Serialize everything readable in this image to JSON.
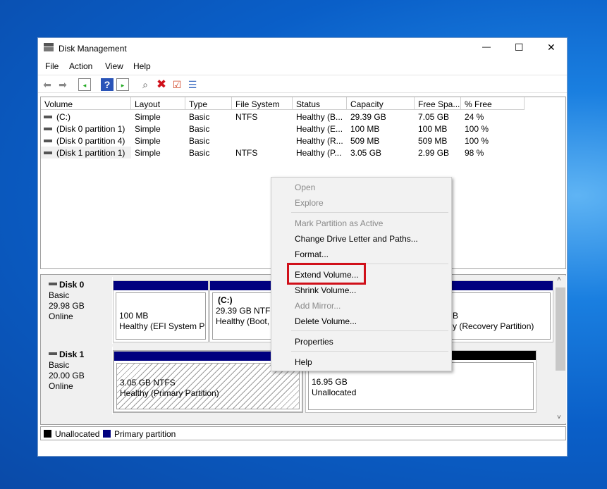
{
  "window": {
    "title": "Disk Management",
    "controls": {
      "minimize": "—",
      "maximize": "☐",
      "close": "✕"
    }
  },
  "menu": [
    "File",
    "Action",
    "View",
    "Help"
  ],
  "toolbar": [
    "back-icon",
    "forward-icon",
    "show-hide-console-tree-icon",
    "help-icon",
    "show-hide-action-pane-icon",
    "connect-disk-icon",
    "delete-icon",
    "properties-icon",
    "list-icon"
  ],
  "columns": [
    "Volume",
    "Layout",
    "Type",
    "File System",
    "Status",
    "Capacity",
    "Free Spa...",
    "% Free"
  ],
  "rows": [
    [
      "(C:)",
      "Simple",
      "Basic",
      "NTFS",
      "Healthy (B...",
      "29.39 GB",
      "7.05 GB",
      "24 %"
    ],
    [
      "(Disk 0 partition 1)",
      "Simple",
      "Basic",
      "",
      "Healthy (E...",
      "100 MB",
      "100 MB",
      "100 %"
    ],
    [
      "(Disk 0 partition 4)",
      "Simple",
      "Basic",
      "",
      "Healthy (R...",
      "509 MB",
      "509 MB",
      "100 %"
    ],
    [
      "(Disk 1 partition 1)",
      "Simple",
      "Basic",
      "NTFS",
      "Healthy (P...",
      "3.05 GB",
      "2.99 GB",
      "98 %"
    ]
  ],
  "disks": [
    {
      "name": "Disk 0",
      "type": "Basic",
      "size": "29.98 GB",
      "status": "Online",
      "partitions": [
        {
          "label": "",
          "size": "100 MB",
          "status": "Healthy (EFI System Pa"
        },
        {
          "label": "(C:)",
          "size": "29.39 GB NTFS",
          "status": "Healthy (Boot,"
        },
        {
          "label": "",
          "size": "B",
          "status": "y (Recovery Partition)"
        }
      ]
    },
    {
      "name": "Disk 1",
      "type": "Basic",
      "size": "20.00 GB",
      "status": "Online",
      "partitions": [
        {
          "size": "3.05 GB NTFS",
          "status": "Healthy (Primary Partition)"
        },
        {
          "size": "16.95 GB",
          "status": "Unallocated"
        }
      ]
    }
  ],
  "legend": [
    {
      "label": "Unallocated",
      "color": "#000000"
    },
    {
      "label": "Primary partition",
      "color": "#00007f"
    }
  ],
  "context_menu": {
    "items": [
      {
        "label": "Open",
        "enabled": false
      },
      {
        "label": "Explore",
        "enabled": false
      },
      {
        "label": "Mark Partition as Active",
        "enabled": false
      },
      {
        "label": "Change Drive Letter and Paths...",
        "enabled": true
      },
      {
        "label": "Format...",
        "enabled": true
      },
      {
        "label": "Extend Volume...",
        "enabled": true,
        "highlighted": true
      },
      {
        "label": "Shrink Volume...",
        "enabled": true
      },
      {
        "label": "Add Mirror...",
        "enabled": false
      },
      {
        "label": "Delete Volume...",
        "enabled": true
      },
      {
        "label": "Properties",
        "enabled": true
      },
      {
        "label": "Help",
        "enabled": true
      }
    ]
  },
  "colors": {
    "primary": "#00007f",
    "unallocated": "#000000",
    "highlight_box": "#d0101a"
  }
}
